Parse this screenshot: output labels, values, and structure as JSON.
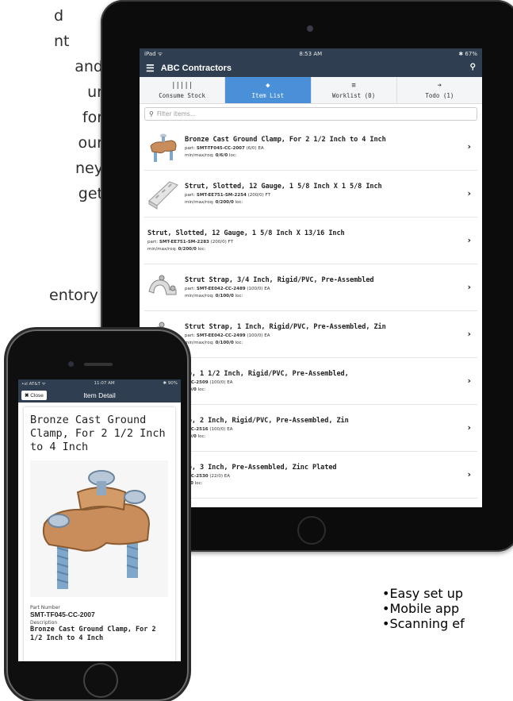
{
  "background_text": {
    "lines": [
      "d",
      "nt",
      "and",
      "ur",
      "for",
      "our",
      "ney",
      "get"
    ],
    "line_inventory": "entory",
    "bullets": [
      "Easy set up",
      "Mobile app",
      "Scanning ef"
    ]
  },
  "ipad": {
    "status": {
      "left": "iPad ᯤ",
      "center": "8:53 AM",
      "right": "✱ 67%"
    },
    "navbar": {
      "title": "ABC Contractors",
      "menu_icon": "menu-icon",
      "search_icon": "search-icon"
    },
    "tabs": [
      {
        "label": "Consume Stock",
        "icon": "barcode-icon",
        "active": false
      },
      {
        "label": "Item List",
        "icon": "tag-icon",
        "active": true
      },
      {
        "label": "Worklist (0)",
        "icon": "list-icon",
        "active": false
      },
      {
        "label": "Todo (1)",
        "icon": "arrow-right-icon",
        "active": false
      }
    ],
    "filter_placeholder": "Filter items...",
    "items": [
      {
        "title": "Bronze Cast Ground Clamp, For 2 1/2 Inch to 4 Inch",
        "part_label": "part:",
        "part": "SMT-TF045-CC-2007",
        "part_extra": "(6/0) EA",
        "mmr_label": "min/max/roq:",
        "mmr": "0/6/0",
        "loc": "loc:",
        "thumb": "clamp"
      },
      {
        "title": "Strut, Slotted, 12 Gauge, 1 5/8 Inch X 1 5/8 Inch",
        "part_label": "part:",
        "part": "SMT-EE751-SM-2254",
        "part_extra": "(200/0) FT",
        "mmr_label": "min/max/roq:",
        "mmr": "0/200/0",
        "loc": "loc:",
        "thumb": "strut"
      },
      {
        "title": "Strut, Slotted, 12 Gauge, 1 5/8 Inch X 13/16 Inch",
        "part_label": "part:",
        "part": "SMT-EE751-SM-2283",
        "part_extra": "(200/0) FT",
        "mmr_label": "min/max/roq:",
        "mmr": "0/200/0",
        "loc": "loc:",
        "thumb": "none"
      },
      {
        "title": "Strut Strap, 3/4 Inch, Rigid/PVC, Pre-Assembled",
        "part_label": "part:",
        "part": "SMT-EE042-CC-2489",
        "part_extra": "(100/0) EA",
        "mmr_label": "min/max/roq:",
        "mmr": "0/100/0",
        "loc": "loc:",
        "thumb": "strap"
      },
      {
        "title": "Strut Strap, 1 Inch, Rigid/PVC, Pre-Assembled, Zin",
        "part_label": "part:",
        "part": "SMT-EE042-CC-2499",
        "part_extra": "(100/0) EA",
        "mmr_label": "min/max/roq:",
        "mmr": "0/100/0",
        "loc": "loc:",
        "thumb": "strap"
      },
      {
        "title": "Strut Strap, 1 1/2 Inch, Rigid/PVC, Pre-Assembled,",
        "part_label": "part:",
        "part": "SMT-EE042-CC-2509",
        "part_extra": "(100/0) EA",
        "mmr_label": "min/max/roq:",
        "mmr": "0/100/0",
        "loc": "loc:",
        "thumb": "none"
      },
      {
        "title": "Strut Strap, 2 Inch, Rigid/PVC, Pre-Assembled, Zin",
        "part_label": "part:",
        "part": "SMT-EE042-CC-2516",
        "part_extra": "(100/0) EA",
        "mmr_label": "min/max/roq:",
        "mmr": "0/100/0",
        "loc": "loc:",
        "thumb": "none"
      },
      {
        "title": "Strut Strap, 3 Inch, Pre-Assembled, Zinc Plated",
        "part_label": "part:",
        "part": "SMT-EE042-CC-2530",
        "part_extra": "(22/0) EA",
        "mmr_label": "min/max/roq:",
        "mmr": "0/30/0",
        "loc": "loc:",
        "thumb": "none"
      }
    ]
  },
  "iphone": {
    "status": {
      "left": "•ııl AT&T ᯤ",
      "center": "11:07 AM",
      "right": "✱ 90%"
    },
    "close_label": "Close",
    "close_icon": "close-icon",
    "title": "Item Detail",
    "item_title": "Bronze Cast Ground Clamp, For 2 1/2 Inch to 4 Inch",
    "part_number_label": "Part Number",
    "part_number": "SMT-TF045-CC-2007",
    "description_label": "Description",
    "description": "Bronze Cast Ground Clamp, For 2 1/2 Inch to 4 Inch"
  },
  "colors": {
    "navbar": "#2f3e50",
    "active_tab": "#4a90d9"
  }
}
